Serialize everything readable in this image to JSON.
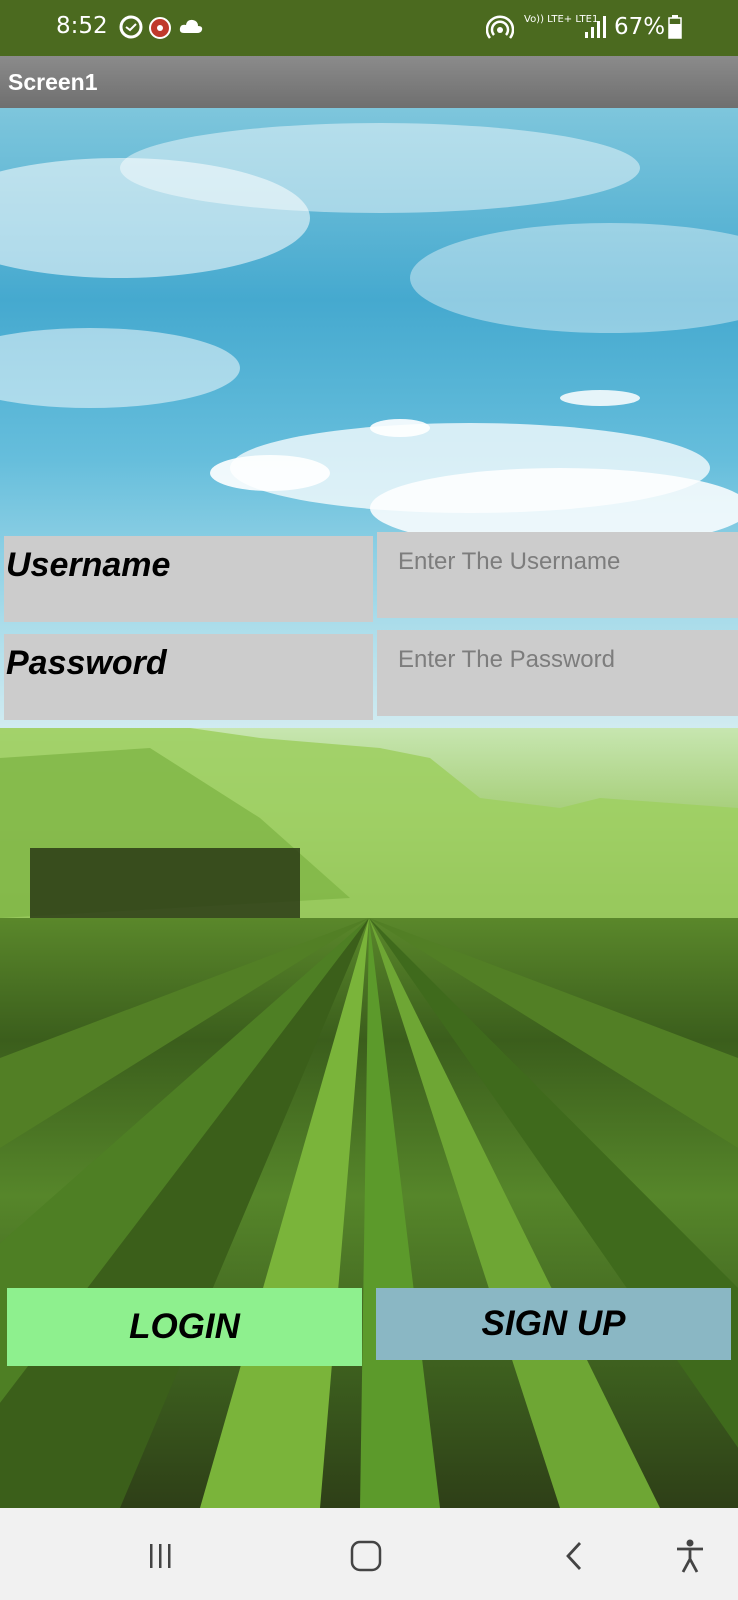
{
  "status_bar": {
    "time": "8:52",
    "network": "Vo)) LTE+ LTE1",
    "battery": "67%"
  },
  "title_bar": {
    "title": "Screen1"
  },
  "form": {
    "username_label": "Username",
    "username_placeholder": "Enter The Username",
    "password_label": "Password",
    "password_placeholder": "Enter The Password"
  },
  "buttons": {
    "login": "LOGIN",
    "signup": "SIGN UP"
  },
  "colors": {
    "status_bar": "#4b6a1f",
    "login_button": "#8ef08e",
    "signup_button": "#8ab7c4",
    "form_field": "#cccccc"
  },
  "nav_bar": {
    "items": [
      "recent-apps-icon",
      "home-icon",
      "back-icon",
      "accessibility-icon"
    ]
  }
}
